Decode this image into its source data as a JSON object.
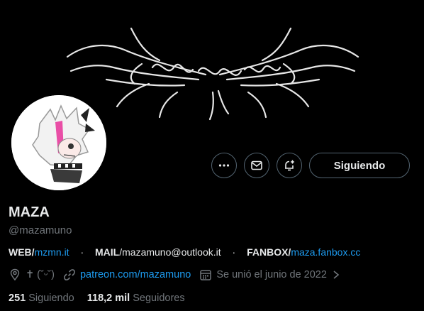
{
  "banner": {
    "logo_alt": "mazamuno gothic logo"
  },
  "actions": {
    "more_icon": "more-horizontal-icon",
    "message_icon": "envelope-icon",
    "notify_icon": "bell-plus-icon",
    "follow_label": "Siguiendo"
  },
  "profile": {
    "name": "MAZA",
    "handle": "@mazamuno"
  },
  "bio": {
    "web_key": "WEB/",
    "web_link": "mzmn.it",
    "mail_key": "MAIL",
    "mail_value": "/mazamuno@outlook.it",
    "fanbox_key": "FANBOX/",
    "fanbox_link": "maza.fanbox.cc",
    "separator": "·"
  },
  "meta": {
    "location": "✝ (˘ᵕ˘)",
    "link": "patreon.com/mazamuno",
    "joined": "Se unió el junio de 2022"
  },
  "stats": {
    "following_count": "251",
    "following_label": "Siguiendo",
    "followers_count": "118,2 mil",
    "followers_label": "Seguidores"
  },
  "colors": {
    "accent": "#1d9bf0",
    "muted": "#71767b",
    "text": "#e7e9ea",
    "bg": "#000000",
    "border": "#536471"
  }
}
